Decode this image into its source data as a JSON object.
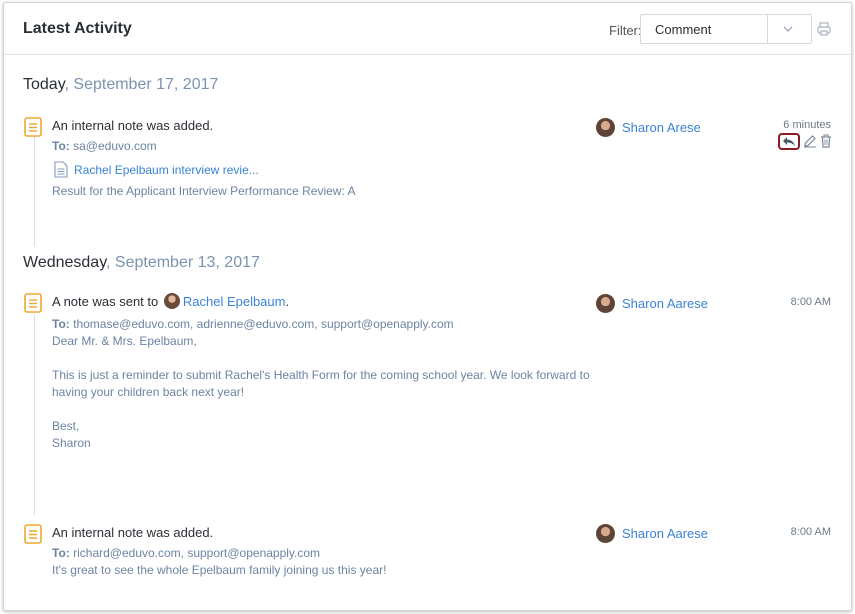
{
  "header": {
    "title": "Latest Activity",
    "filter_label": "Filter:",
    "filter_value": "Comment"
  },
  "groups": [
    {
      "day": "Today",
      "date": ", September 17, 2017",
      "entries": [
        {
          "title": "An internal note was added.",
          "to_label": "To:",
          "to": "sa@eduvo.com",
          "attachment": "Rachel Epelbaum interview revie...",
          "body": "Result for the Applicant Interview Performance Review:  A",
          "author": "Sharon Arese",
          "time": "6 minutes"
        }
      ]
    },
    {
      "day": "Wednesday",
      "date": ", September 13, 2017",
      "entries": [
        {
          "title_prefix": "A note was sent to",
          "title_link": "Rachel Epelbaum",
          "title_suffix": ".",
          "to_label": "To:",
          "to": "thomase@eduvo.com, adrienne@eduvo.com, support@openapply.com",
          "body_lines": [
            "Dear Mr. & Mrs. Epelbaum,",
            "",
            "This is just a reminder to submit Rachel's Health Form for the coming school year. We look forward to",
            "having your children back next year!",
            "",
            "Best,",
            "Sharon"
          ],
          "author": "Sharon Aarese",
          "time": "8:00 AM"
        },
        {
          "title": "An internal note was added.",
          "to_label": "To:",
          "to": "richard@eduvo.com, support@openapply.com",
          "body": "It's great to see the whole Epelbaum family joining us this year!",
          "author": "Sharon Aarese",
          "time": "8:00 AM"
        }
      ]
    }
  ],
  "colors": {
    "accent_link": "#3a83d6",
    "note_icon": "#f0a830",
    "muted_text": "#6c84a3",
    "highlight_border": "#8a1c24"
  }
}
